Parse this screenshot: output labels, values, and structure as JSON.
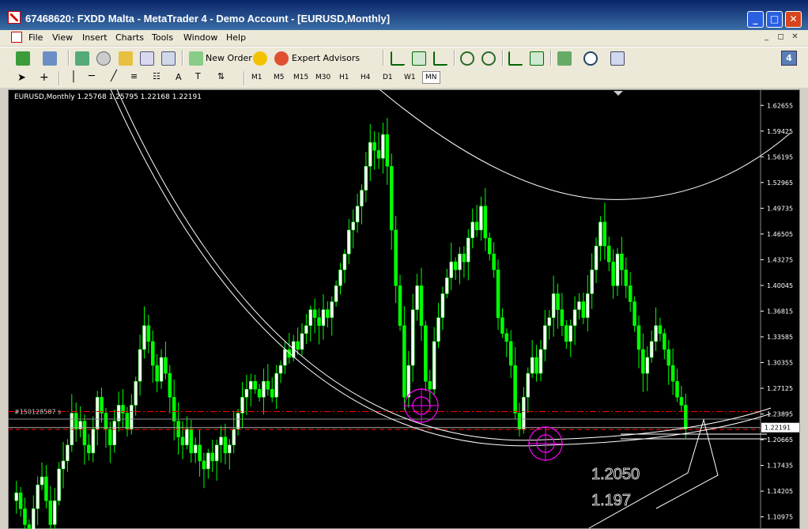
{
  "window": {
    "title": "67468620: FXDD Malta - MetaTrader 4 - Demo Account - [EURUSD,Monthly]",
    "min_glyph": "_",
    "max_glyph": "□",
    "close_glyph": "✕"
  },
  "menu": {
    "items": [
      "File",
      "View",
      "Insert",
      "Charts",
      "Tools",
      "Window",
      "Help"
    ],
    "mdi": [
      "_",
      "◻",
      "✕"
    ]
  },
  "toolbar": {
    "new_order": "New Order",
    "expert_advisors": "Expert Advisors",
    "badge_count": "4",
    "timeframes": [
      "M1",
      "M5",
      "M15",
      "M30",
      "H1",
      "H4",
      "D1",
      "W1",
      "MN"
    ],
    "active_timeframe": "MN",
    "text_tool": "A"
  },
  "chart": {
    "info": "EURUSD,Monthly  1.25768 1.25795 1.22168 1.22191",
    "order_label": "#150128587 s",
    "current_price": "1.22191",
    "price_labels": [
      "1.62655",
      "1.59425",
      "1.56195",
      "1.52965",
      "1.49735",
      "1.46505",
      "1.43275",
      "1.40045",
      "1.36815",
      "1.33585",
      "1.30355",
      "1.27125",
      "1.23895",
      "1.20665",
      "1.17435",
      "1.14205",
      "1.10975"
    ],
    "annotations": [
      "1.2050",
      "1.197"
    ],
    "colors": {
      "bull": "#ffffff",
      "bear": "#00ff00",
      "background": "#000000",
      "level_line": "#ff0000",
      "circle_marker": "#ff00ff",
      "current_price_box": "#ffffff"
    }
  },
  "chart_data": {
    "type": "candlestick",
    "symbol": "EURUSD",
    "timeframe": "Monthly",
    "ohlc_last": {
      "open": 1.25768,
      "high": 1.25795,
      "low": 1.22168,
      "close": 1.22191
    },
    "y_ticks": [
      1.62655,
      1.59425,
      1.56195,
      1.52965,
      1.49735,
      1.46505,
      1.43275,
      1.40045,
      1.36815,
      1.33585,
      1.30355,
      1.27125,
      1.23895,
      1.20665,
      1.17435,
      1.14205,
      1.10975
    ],
    "ylim": [
      1.0945,
      1.6427
    ],
    "closes": [
      1.14,
      1.12,
      1.1,
      1.08,
      1.12,
      1.15,
      1.16,
      1.13,
      1.1,
      1.13,
      1.17,
      1.18,
      1.2,
      1.24,
      1.22,
      1.23,
      1.2,
      1.19,
      1.22,
      1.26,
      1.24,
      1.22,
      1.2,
      1.23,
      1.25,
      1.24,
      1.22,
      1.25,
      1.28,
      1.32,
      1.35,
      1.33,
      1.3,
      1.28,
      1.31,
      1.29,
      1.26,
      1.23,
      1.21,
      1.2,
      1.22,
      1.19,
      1.2,
      1.18,
      1.17,
      1.19,
      1.18,
      1.2,
      1.21,
      1.19,
      1.2,
      1.22,
      1.24,
      1.26,
      1.27,
      1.28,
      1.27,
      1.26,
      1.28,
      1.27,
      1.26,
      1.29,
      1.3,
      1.32,
      1.31,
      1.33,
      1.32,
      1.34,
      1.35,
      1.37,
      1.36,
      1.35,
      1.37,
      1.36,
      1.38,
      1.4,
      1.42,
      1.44,
      1.47,
      1.48,
      1.5,
      1.52,
      1.55,
      1.58,
      1.57,
      1.56,
      1.59,
      1.55,
      1.47,
      1.4,
      1.35,
      1.26,
      1.3,
      1.37,
      1.4,
      1.35,
      1.28,
      1.27,
      1.33,
      1.36,
      1.39,
      1.41,
      1.43,
      1.42,
      1.44,
      1.43,
      1.46,
      1.48,
      1.47,
      1.5,
      1.46,
      1.44,
      1.42,
      1.36,
      1.34,
      1.33,
      1.3,
      1.24,
      1.22,
      1.26,
      1.29,
      1.31,
      1.29,
      1.32,
      1.35,
      1.36,
      1.39,
      1.37,
      1.35,
      1.33,
      1.35,
      1.37,
      1.38,
      1.36,
      1.39,
      1.42,
      1.45,
      1.48,
      1.45,
      1.43,
      1.4,
      1.44,
      1.42,
      1.4,
      1.38,
      1.35,
      1.32,
      1.29,
      1.31,
      1.33,
      1.35,
      1.34,
      1.32,
      1.3,
      1.28,
      1.26,
      1.25,
      1.22
    ],
    "annotations": [
      1.205,
      1.197
    ]
  }
}
